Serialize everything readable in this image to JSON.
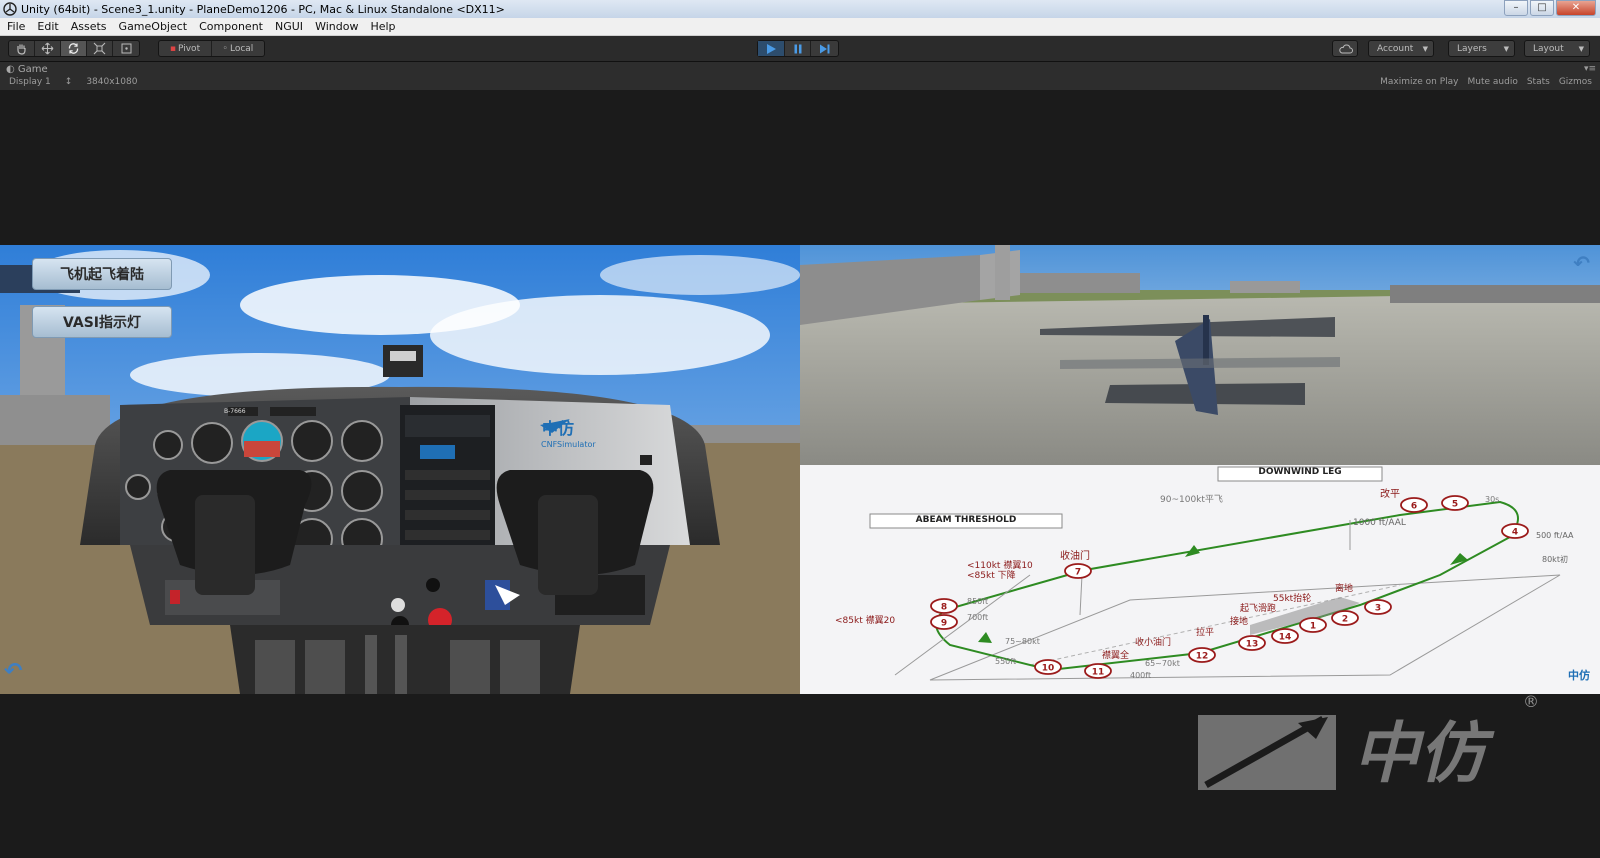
{
  "window": {
    "title": "Unity (64bit) - Scene3_1.unity - PlaneDemo1206 - PC, Mac & Linux Standalone <DX11>",
    "controls": [
      "–",
      "□",
      "✕"
    ]
  },
  "menubar": [
    "File",
    "Edit",
    "Assets",
    "GameObject",
    "Component",
    "NGUI",
    "Window",
    "Help"
  ],
  "toolbar": {
    "pivot": "Pivot",
    "local": "Local",
    "account": "Account",
    "layers": "Layers",
    "layout": "Layout"
  },
  "game_panel": {
    "tab": "Game",
    "display": "Display 1",
    "resolution": "3840x1080",
    "options": [
      "Maximize on Play",
      "Mute audio",
      "Stats",
      "Gizmos"
    ]
  },
  "left_view": {
    "btn1": "飞机起飞着陆",
    "btn2": "VASI指示灯",
    "panel_logo": "中仿",
    "panel_sub": "CNFSimulator",
    "tail": "B-7666"
  },
  "diagram": {
    "downwind": "DOWNWIND LEG",
    "abeam": "ABEAM THRESHOLD",
    "labels": {
      "l1": "90~100kt平飞",
      "l2": "改平",
      "l3": "1000 ft/AAL",
      "l4": "30s",
      "l5": "500 ft/AA",
      "l6": "80kt初",
      "l7": "收油门",
      "l8": "<110kt 襟翼10",
      "l9": "<85kt  下降",
      "l10": "850ft",
      "l11": "<85kt 襟翼20",
      "l12": "700ft",
      "l13": "75~80kt",
      "l14": "550ft",
      "l15": "襟翼全",
      "l16": "65~70kt",
      "l17": "400ft",
      "l18": "收小油门",
      "l19": "拉平",
      "l20": "接地",
      "l21": "起飞滑跑",
      "l22": "55kt抬轮",
      "l23": "离地"
    },
    "points": [
      "1",
      "2",
      "3",
      "4",
      "5",
      "6",
      "7",
      "8",
      "9",
      "10",
      "11",
      "12",
      "13",
      "14"
    ],
    "logo": "中仿"
  },
  "watermark": {
    "text": "中仿",
    "reg": "®"
  },
  "colors": {
    "play_blue": "#4a9be6",
    "route_green": "#2e8b22",
    "waypoint_red": "#9b1b1b"
  }
}
